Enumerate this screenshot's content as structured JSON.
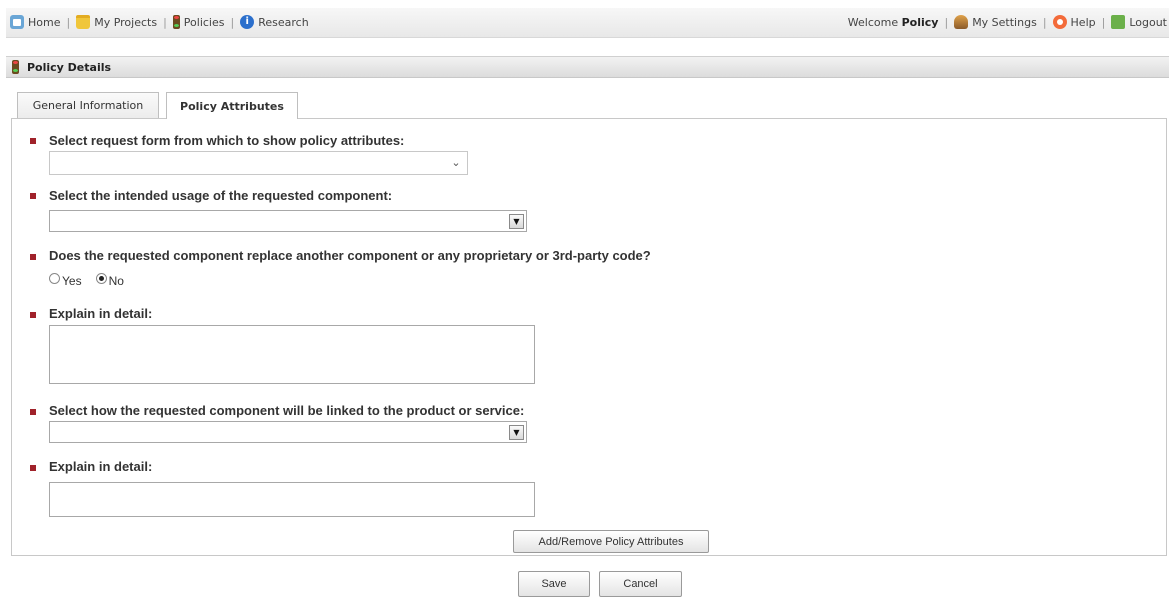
{
  "nav": {
    "home": "Home",
    "my_projects": "My Projects",
    "policies": "Policies",
    "research": "Research",
    "welcome_prefix": "Welcome",
    "welcome_user": "Policy",
    "my_settings": "My Settings",
    "help": "Help",
    "logout": "Logout"
  },
  "section": {
    "title": "Policy Details"
  },
  "tabs": [
    {
      "label": "General Information",
      "active": false
    },
    {
      "label": "Policy Attributes",
      "active": true
    }
  ],
  "form": {
    "q1": {
      "label": "Select request form from which to show policy attributes:",
      "value": ""
    },
    "q2": {
      "label": "Select the intended usage of the requested component:",
      "value": ""
    },
    "q3": {
      "label": "Does the requested component replace another component or any proprietary or 3rd-party code?",
      "options": [
        "Yes",
        "No"
      ],
      "selected": "No"
    },
    "q4": {
      "label": "Explain in detail:",
      "value": ""
    },
    "q5": {
      "label": "Select how the requested component will be linked to the product or service:",
      "value": ""
    },
    "q6": {
      "label": "Explain in detail:",
      "value": ""
    }
  },
  "buttons": {
    "add_remove": "Add/Remove Policy Attributes",
    "save": "Save",
    "cancel": "Cancel"
  },
  "colors": {
    "bullet": "#a0222a"
  }
}
